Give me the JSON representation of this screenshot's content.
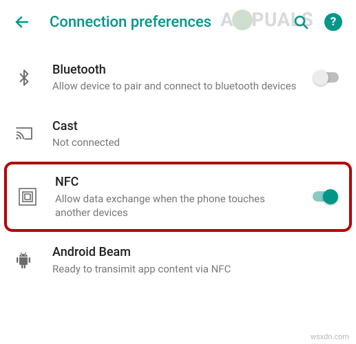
{
  "header": {
    "title": "Connection preferences"
  },
  "items": {
    "bluetooth": {
      "title": "Bluetooth",
      "subtitle": "Allow device to pair and connect to bluetooth devices",
      "switch_on": false
    },
    "cast": {
      "title": "Cast",
      "subtitle": "Not connected"
    },
    "nfc": {
      "title": "NFC",
      "subtitle": "Allow data exchange when the phone touches another devices",
      "switch_on": true
    },
    "android_beam": {
      "title": "Android Beam",
      "subtitle": "Ready to transimit app content via NFC"
    }
  },
  "watermark": {
    "prefix": "A",
    "suffix": "PUALS"
  },
  "footer": "wsxdn.com",
  "colors": {
    "accent": "#009688",
    "highlight_border": "#b30000"
  }
}
